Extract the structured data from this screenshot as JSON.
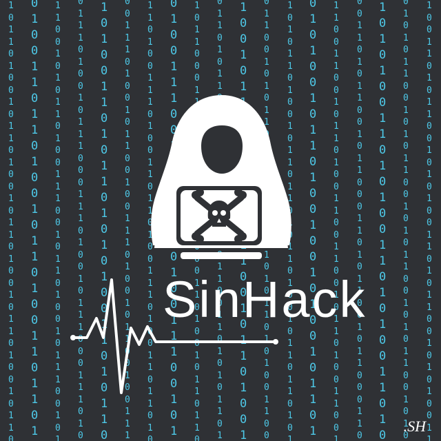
{
  "brand": {
    "name": "SinHack",
    "signature": ".SH"
  },
  "colors": {
    "background": "#2f3135",
    "binary_digits": "#4ec9e8",
    "emblem": "#ffffff"
  },
  "icons": {
    "emblem": "hooded-hacker-icon",
    "laptop_symbol": "skull-crossbones-icon",
    "underline": "heartbeat-line-icon"
  },
  "binary_rain": {
    "columns": [
      "1011010010110100101101001011010010110100101",
      "0100110110100101101001101101001011010011011",
      "1100101011010011100101101001011100101011010",
      "0111010010111000111010010111000111010010111",
      "1010011010110101010011010110101010011010110",
      "0011101001011001001110100101100100111010010",
      "1101001110100110110100111010011011010011101",
      "0100111001011010010011100101101001001110010",
      "1011000110100101101100011010010110110001101",
      "0110101100110101011010110011010101101011001",
      "1001011010011001100101101001100110010110100",
      "0110010101101010011001010110101001100101011",
      "1010110100101101101011010010110110101101001",
      "0101001011010010010100101101001001010010110",
      "1100110010110100110011001011010011001100101",
      "0011010110010110001101011001011000110101100",
      "1010100110101001101010011010100110101001101",
      "0101011001010110010101100101011001010110010",
      "1001101011001010100110101100101010011010110"
    ]
  }
}
